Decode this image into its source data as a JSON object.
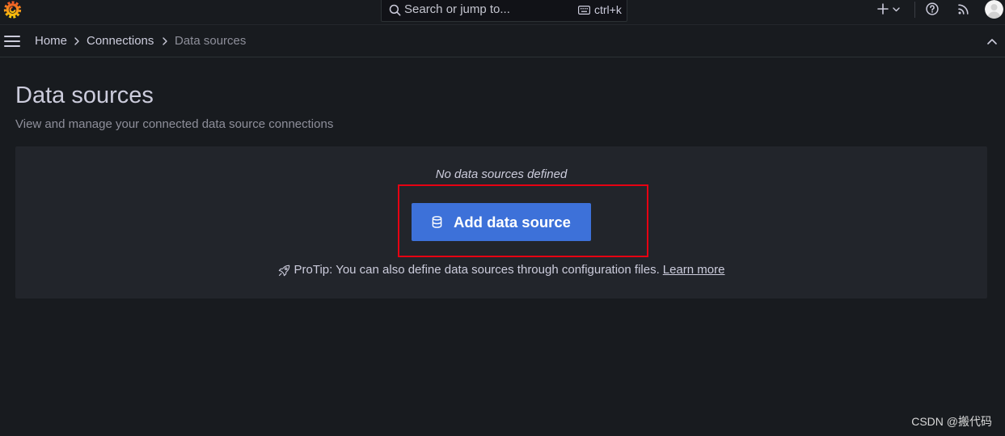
{
  "colors": {
    "background": "#181b1f",
    "panel": "#22252b",
    "border": "#2c3235",
    "text": "#ccccdc",
    "primary_button": "#3d71d9",
    "highlight_box": "#e60012"
  },
  "topbar": {
    "logo_icon": "grafana-logo-icon",
    "search": {
      "icon": "search-icon",
      "placeholder": "Search or jump to...",
      "shortcut_icon": "keyboard-icon",
      "shortcut": "ctrl+k"
    },
    "actions": [
      {
        "icon": "plus-icon",
        "dropdown_icon": "chevron-down-icon"
      },
      {
        "icon": "help-icon"
      },
      {
        "icon": "rss-icon"
      },
      {
        "icon": "user-avatar"
      }
    ]
  },
  "navbar": {
    "menu_icon": "hamburger-menu-icon",
    "breadcrumb": [
      {
        "label": "Home"
      },
      {
        "label": "Connections"
      },
      {
        "label": "Data sources"
      }
    ],
    "separator_icon": "chevron-right-icon",
    "dock_toggle_icon": "chevron-up-icon"
  },
  "page": {
    "title": "Data sources",
    "subtitle": "View and manage your connected data source connections"
  },
  "empty_state": {
    "message": "No data sources defined",
    "button": {
      "icon": "database-icon",
      "label": "Add data source"
    },
    "protip": {
      "icon": "rocket-icon",
      "text": "ProTip: You can also define data sources through configuration files.",
      "link": "Learn more"
    }
  },
  "watermark": "CSDN @搬代码"
}
